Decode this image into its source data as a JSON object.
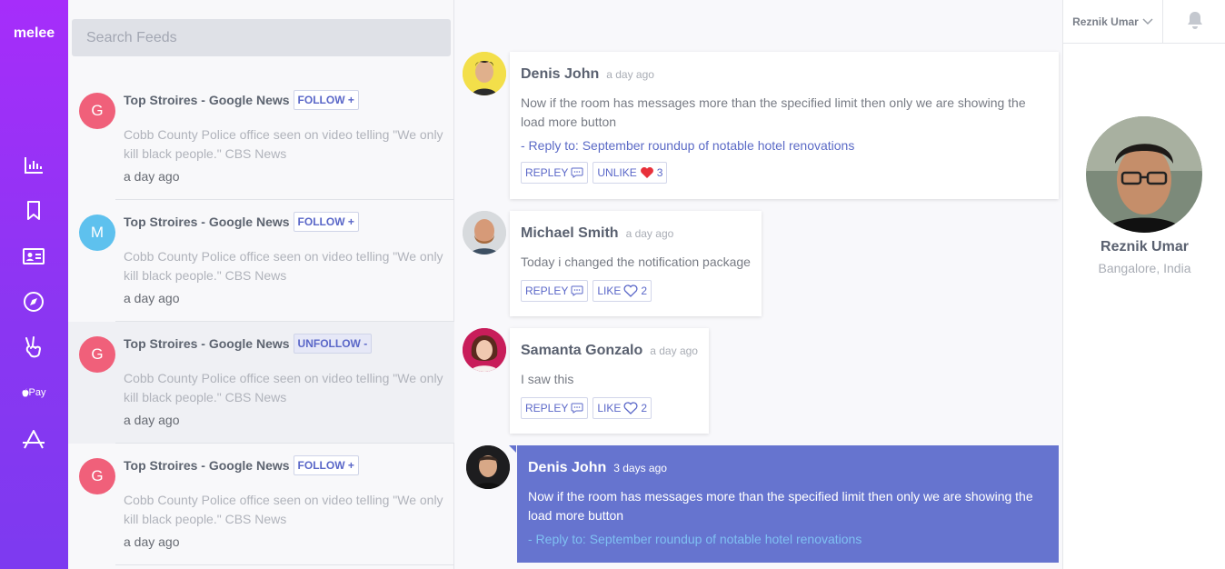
{
  "app": {
    "brand": "melee"
  },
  "nav": {
    "items": [
      {
        "icon": "bar-chart-icon"
      },
      {
        "icon": "bookmark-icon"
      },
      {
        "icon": "id-card-icon"
      },
      {
        "icon": "compass-icon"
      },
      {
        "icon": "victory-hand-icon"
      },
      {
        "icon": "apple-pay-icon",
        "label": "Pay"
      },
      {
        "icon": "angular-logo-icon"
      }
    ]
  },
  "search": {
    "placeholder": "Search Feeds"
  },
  "feeds": [
    {
      "initial": "G",
      "color": "#f0607a",
      "title": "Top Stroires - Google News",
      "action": "FOLLOW +",
      "body": "Cobb County Police office seen on video telling \"We only kill black people.\" CBS News",
      "time": "a day ago",
      "active": false
    },
    {
      "initial": "M",
      "color": "#5ec1ee",
      "title": "Top Stroires - Google News",
      "action": "FOLLOW +",
      "body": "Cobb County Police office seen on video telling \"We only kill black people.\" CBS News",
      "time": "a day ago",
      "active": false
    },
    {
      "initial": "G",
      "color": "#f0607a",
      "title": "Top Stroires - Google News",
      "action": "UNFOLLOW -",
      "body": "Cobb County Police office seen on video telling \"We only kill black people.\" CBS News",
      "time": "a day ago",
      "active": true
    },
    {
      "initial": "G",
      "color": "#f0607a",
      "title": "Top Stroires - Google News",
      "action": "FOLLOW +",
      "body": "Cobb County Police office seen on video telling \"We only kill black people.\" CBS News",
      "time": "a day ago",
      "active": false
    }
  ],
  "comments": [
    {
      "name": "Denis John",
      "time": "a day ago",
      "text": "Now if the room has messages more than the specified limit then only we are showing the load more button",
      "reply_to": "- Reply to: September roundup of notable hotel renovations",
      "reply_label": "REPLEY",
      "like_label": "UNLIKE",
      "like_count": "3",
      "liked": true
    },
    {
      "name": "Michael Smith",
      "time": "a day ago",
      "text": "Today i changed the notification package",
      "reply_label": "REPLEY",
      "like_label": "LIKE",
      "like_count": "2",
      "liked": false
    },
    {
      "name": "Samanta Gonzalo",
      "time": "a day ago",
      "text": "I saw this",
      "reply_label": "REPLEY",
      "like_label": "LIKE",
      "like_count": "2",
      "liked": false
    },
    {
      "name": "Denis John",
      "time": "3 days ago",
      "text": "Now if the room has messages more than the specified limit then only we are showing the load more button",
      "reply_to": "- Reply to: September roundup of notable hotel renovations",
      "highlighted": true
    }
  ],
  "user": {
    "menu_name": "Reznik Umar",
    "name": "Reznik Umar",
    "location": "Bangalore, India"
  },
  "colors": {
    "accent": "#6674cf",
    "rail_top": "#a62dfa",
    "rail_bottom": "#7d3af0",
    "heart": "#e8303a"
  }
}
